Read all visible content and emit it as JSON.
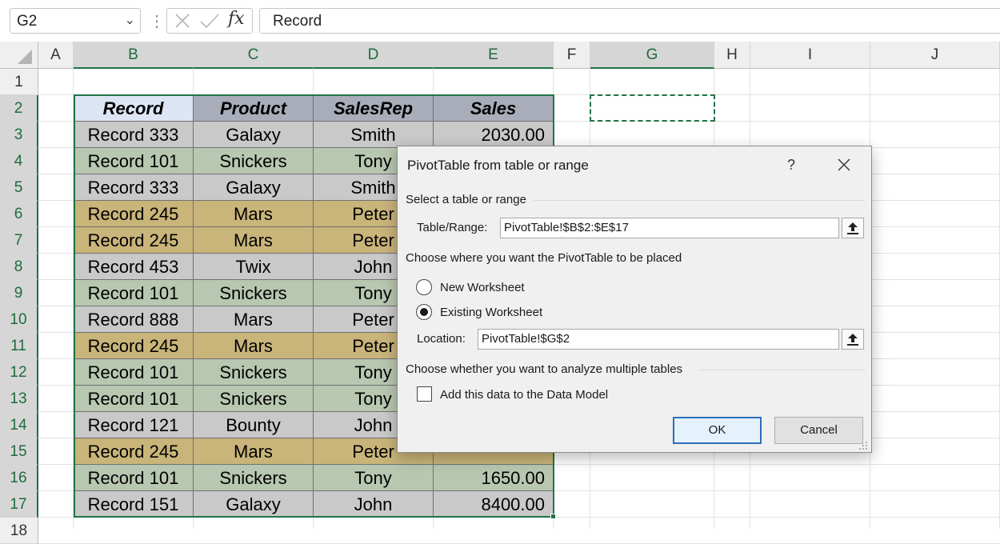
{
  "formula_bar": {
    "name_box": "G2",
    "formula": "Record",
    "fx_label": "fx"
  },
  "columns": [
    "A",
    "B",
    "C",
    "D",
    "E",
    "F",
    "G",
    "H",
    "I",
    "J"
  ],
  "rows": [
    "1",
    "2",
    "3",
    "4",
    "5",
    "6",
    "7",
    "8",
    "9",
    "10",
    "11",
    "12",
    "13",
    "14",
    "15",
    "16",
    "17",
    "18"
  ],
  "selected_column": "G",
  "selected_row": "2",
  "table": {
    "headers": [
      "Record",
      "Product",
      "SalesRep",
      "Sales"
    ],
    "rows": [
      {
        "record": "Record 333",
        "product": "Galaxy",
        "rep": "Smith",
        "sales": "2030.00",
        "color": "#c9c9c9"
      },
      {
        "record": "Record 101",
        "product": "Snickers",
        "rep": "Tony",
        "sales": "",
        "color": "#b8c7b0"
      },
      {
        "record": "Record 333",
        "product": "Galaxy",
        "rep": "Smith",
        "sales": "",
        "color": "#c9c9c9"
      },
      {
        "record": "Record 245",
        "product": "Mars",
        "rep": "Peter",
        "sales": "",
        "color": "#c9b47a"
      },
      {
        "record": "Record 245",
        "product": "Mars",
        "rep": "Peter",
        "sales": "",
        "color": "#c9b47a"
      },
      {
        "record": "Record 453",
        "product": "Twix",
        "rep": "John",
        "sales": "",
        "color": "#c9c9c9"
      },
      {
        "record": "Record 101",
        "product": "Snickers",
        "rep": "Tony",
        "sales": "",
        "color": "#b8c7b0"
      },
      {
        "record": "Record 888",
        "product": "Mars",
        "rep": "Peter",
        "sales": "",
        "color": "#c9c9c9"
      },
      {
        "record": "Record 245",
        "product": "Mars",
        "rep": "Peter",
        "sales": "",
        "color": "#c9b47a"
      },
      {
        "record": "Record 101",
        "product": "Snickers",
        "rep": "Tony",
        "sales": "",
        "color": "#b8c7b0"
      },
      {
        "record": "Record 101",
        "product": "Snickers",
        "rep": "Tony",
        "sales": "",
        "color": "#b8c7b0"
      },
      {
        "record": "Record 121",
        "product": "Bounty",
        "rep": "John",
        "sales": "",
        "color": "#c9c9c9"
      },
      {
        "record": "Record 245",
        "product": "Mars",
        "rep": "Peter",
        "sales": "",
        "color": "#c9b47a"
      },
      {
        "record": "Record 101",
        "product": "Snickers",
        "rep": "Tony",
        "sales": "1650.00",
        "color": "#b8c7b0"
      },
      {
        "record": "Record 151",
        "product": "Galaxy",
        "rep": "John",
        "sales": "8400.00",
        "color": "#c9c9c9"
      }
    ],
    "header_colors": [
      "#dde5f4",
      "#a9adb9",
      "#a9adb9",
      "#a9adb9"
    ]
  },
  "dialog": {
    "title": "PivotTable from table or range",
    "help": "?",
    "section_select": "Select a table or range",
    "table_range_label": "Table/Range:",
    "table_range_value": "PivotTable!$B$2:$E$17",
    "section_place": "Choose where you want the PivotTable to be placed",
    "opt_new": "New Worksheet",
    "opt_existing": "Existing Worksheet",
    "selected_option": "existing",
    "location_label": "Location:",
    "location_value": "PivotTable!$G$2",
    "section_multi": "Choose whether you want to analyze multiple tables",
    "data_model_label": "Add this data to the Data Model",
    "data_model_checked": false,
    "ok_label": "OK",
    "cancel_label": "Cancel"
  }
}
